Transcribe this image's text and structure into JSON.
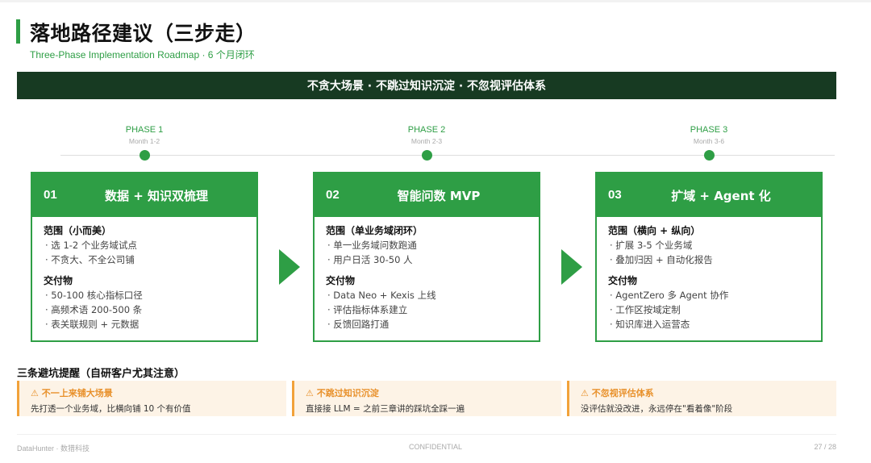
{
  "header": {
    "title": "落地路径建议（三步走）",
    "subtitle": "Three-Phase Implementation Roadmap · 6 个月闭环"
  },
  "banner": {
    "text": "不贪大场景 · 不跳过知识沉淀 · 不忽视评估体系"
  },
  "phases": [
    {
      "label": "PHASE 1",
      "months": "Month 1-2"
    },
    {
      "label": "PHASE 2",
      "months": "Month 2-3"
    },
    {
      "label": "PHASE 3",
      "months": "Month 3-6"
    }
  ],
  "cards": [
    {
      "num": "01",
      "name": "数据 + 知识双梳理",
      "scope_title": "范围（小而美）",
      "scope": [
        "· 选 1-2 个业务域试点",
        "· 不贪大、不全公司铺"
      ],
      "deliver_title": "交付物",
      "deliverables": [
        "· 50-100 核心指标口径",
        "· 高频术语 200-500 条",
        "· 表关联规则 + 元数据"
      ]
    },
    {
      "num": "02",
      "name": "智能问数 MVP",
      "scope_title": "范围（单业务域闭环）",
      "scope": [
        "· 单一业务域问数跑通",
        "· 用户日活 30-50 人"
      ],
      "deliver_title": "交付物",
      "deliverables": [
        "· Data Neo + Kexis 上线",
        "· 评估指标体系建立",
        "· 反馈回路打通"
      ]
    },
    {
      "num": "03",
      "name": "扩域 + Agent 化",
      "scope_title": "范围（横向 + 纵向）",
      "scope": [
        "· 扩展 3-5 个业务域",
        "· 叠加归因 + 自动化报告"
      ],
      "deliver_title": "交付物",
      "deliverables": [
        "· AgentZero 多 Agent 协作",
        "· 工作区按域定制",
        "· 知识库进入运营态"
      ]
    }
  ],
  "pitfalls": {
    "title": "三条避坑提醒（自研客户尤其注意）",
    "items": [
      {
        "head": "⚠ 不一上来铺大场景",
        "text": "先打透一个业务域，比横向铺 10 个有价值"
      },
      {
        "head": "⚠ 不跳过知识沉淀",
        "text": "直接接 LLM = 之前三章讲的踩坑全踩一遍"
      },
      {
        "head": "⚠ 不忽视评估体系",
        "text": "没评估就没改进，永远停在\"看着像\"阶段"
      }
    ]
  },
  "footer": {
    "left": "DataHunter · 数猎科技",
    "center": "CONFIDENTIAL",
    "right": "27 / 28"
  },
  "colors": {
    "accent": "#2e9e45",
    "banner": "#173a22",
    "warn": "#f2a23a",
    "warn_bg": "#fdf3e6"
  }
}
